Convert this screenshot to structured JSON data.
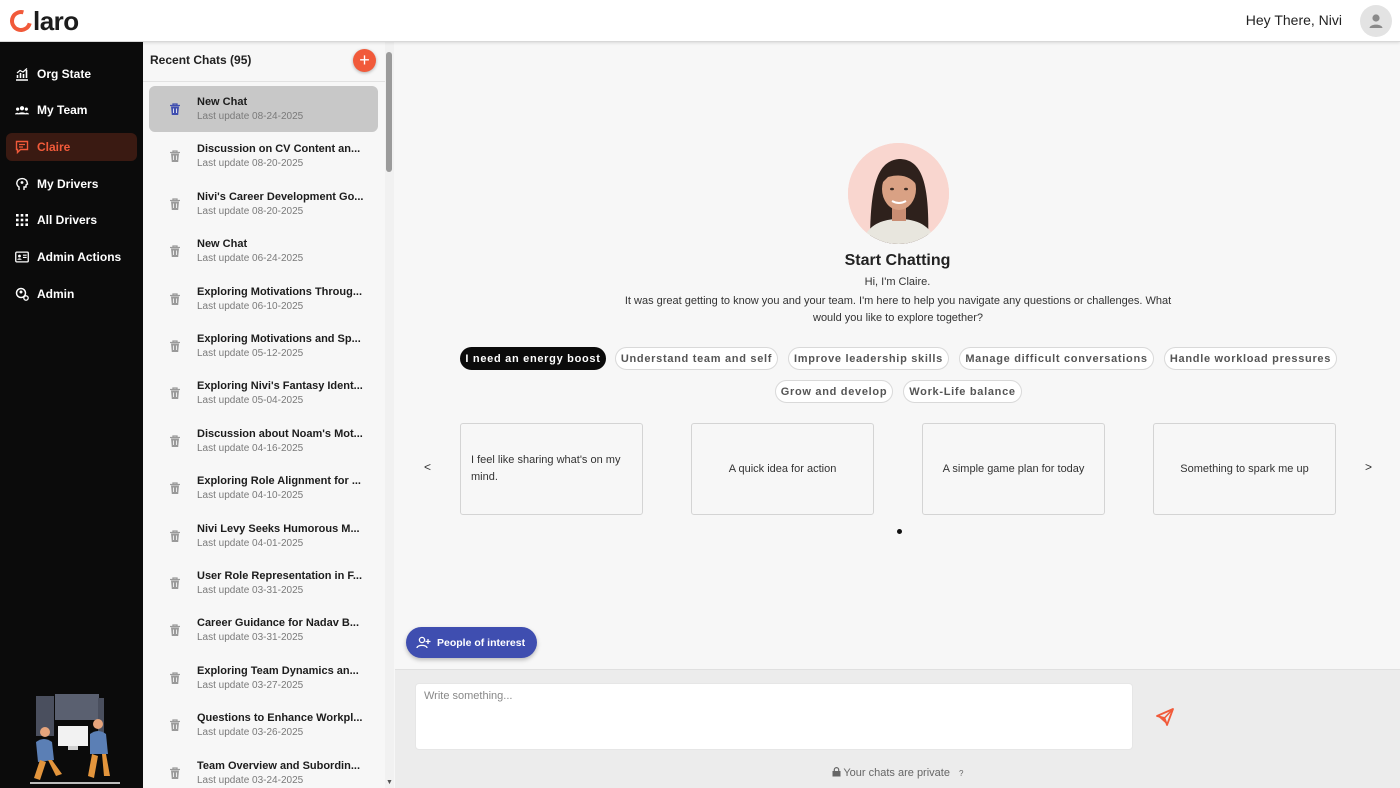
{
  "app": {
    "logo_text": "laro",
    "greeting": "Hey There, Nivi",
    "accent": "#f15a3a"
  },
  "sidebar": {
    "items": [
      {
        "label": "Org State",
        "icon": "chart-icon"
      },
      {
        "label": "My Team",
        "icon": "team-icon"
      },
      {
        "label": "Claire",
        "icon": "chat-icon",
        "active": true
      },
      {
        "label": "My Drivers",
        "icon": "head-icon"
      },
      {
        "label": "All Drivers",
        "icon": "grid-icon"
      },
      {
        "label": "Admin Actions",
        "icon": "id-card-icon"
      },
      {
        "label": "Admin",
        "icon": "admin-icon"
      }
    ]
  },
  "chats": {
    "title": "Recent Chats (95)",
    "add_label": "+",
    "items": [
      {
        "title": "New Chat",
        "date": "Last update 08-24-2025"
      },
      {
        "title": "Discussion on CV Content an...",
        "date": "Last update 08-20-2025"
      },
      {
        "title": "Nivi's Career Development Go...",
        "date": "Last update 08-20-2025"
      },
      {
        "title": "New Chat",
        "date": "Last update 06-24-2025"
      },
      {
        "title": "Exploring Motivations Throug...",
        "date": "Last update 06-10-2025"
      },
      {
        "title": "Exploring Motivations and Sp...",
        "date": "Last update 05-12-2025"
      },
      {
        "title": "Exploring Nivi's Fantasy Ident...",
        "date": "Last update 05-04-2025"
      },
      {
        "title": "Discussion about Noam's Mot...",
        "date": "Last update 04-16-2025"
      },
      {
        "title": "Exploring Role Alignment for ...",
        "date": "Last update 04-10-2025"
      },
      {
        "title": "Nivi Levy Seeks Humorous M...",
        "date": "Last update 04-01-2025"
      },
      {
        "title": "User Role Representation in F...",
        "date": "Last update 03-31-2025"
      },
      {
        "title": "Career Guidance for Nadav B...",
        "date": "Last update 03-31-2025"
      },
      {
        "title": "Exploring Team Dynamics an...",
        "date": "Last update 03-27-2025"
      },
      {
        "title": "Questions to Enhance Workpl...",
        "date": "Last update 03-26-2025"
      },
      {
        "title": "Team Overview and Subordin...",
        "date": "Last update 03-24-2025"
      }
    ]
  },
  "main": {
    "title": "Start Chatting",
    "hi": "Hi, I'm Claire.",
    "intro": "It was great getting to know you and your team. I'm here to help you navigate any questions or challenges. What would you like to explore together?",
    "chips": [
      {
        "label": "I need an energy boost",
        "active": true
      },
      {
        "label": "Understand team and self"
      },
      {
        "label": "Improve leadership skills"
      },
      {
        "label": "Manage difficult conversations"
      },
      {
        "label": "Handle workload pressures"
      },
      {
        "label": "Grow and develop"
      },
      {
        "label": "Work-Life balance"
      }
    ],
    "cards": [
      "I feel like sharing what's on my mind.",
      "A quick idea for action",
      "A simple game plan for today",
      "Something to spark me up"
    ],
    "prev_label": "<",
    "next_label": ">",
    "people_button": "People of interest",
    "input_placeholder": "Write something...",
    "privacy_note": "Your chats are private",
    "privacy_help": "?"
  }
}
